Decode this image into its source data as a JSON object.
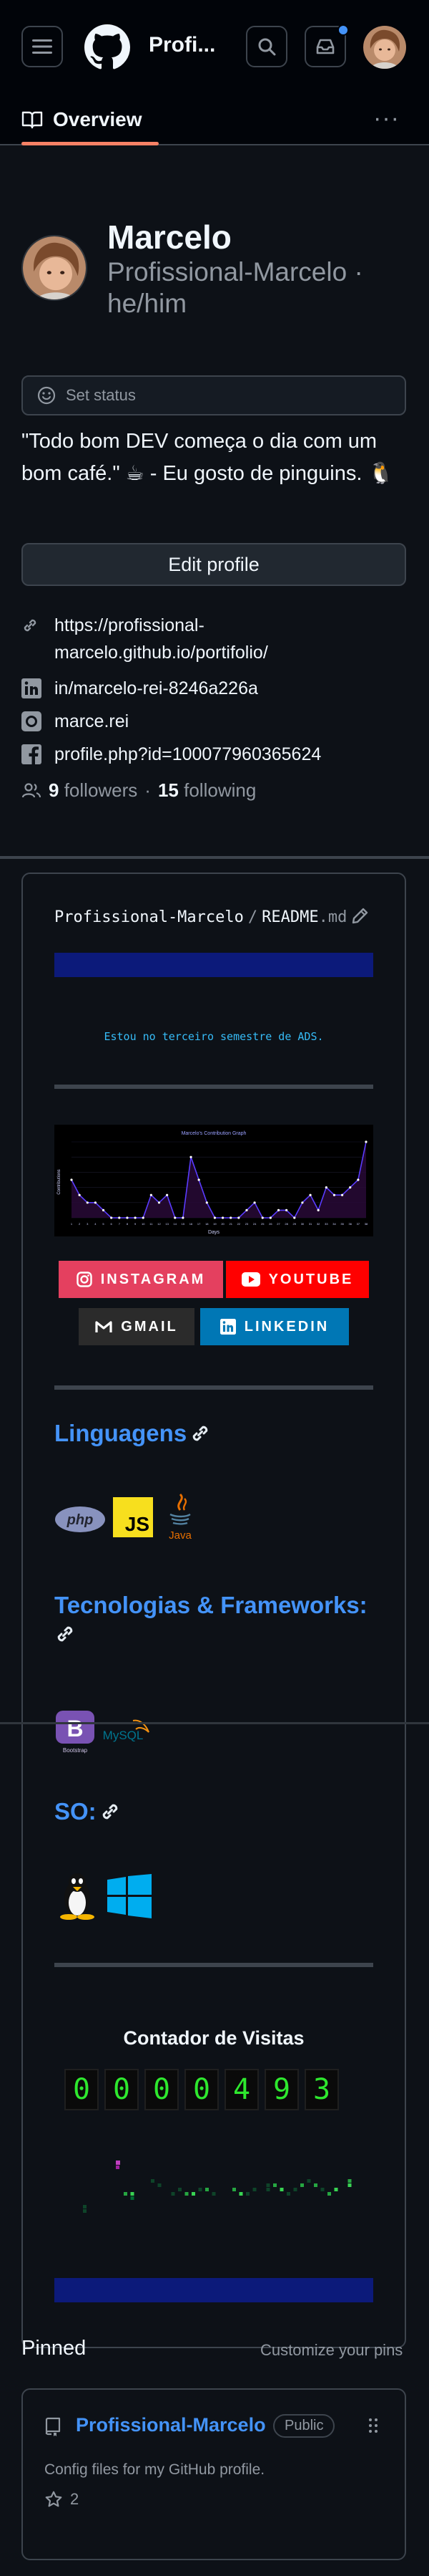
{
  "header": {
    "title": "Profi...",
    "icons": [
      "hamburger-menu-icon",
      "github-logo-icon",
      "search-icon",
      "inbox-icon",
      "avatar"
    ],
    "notification_dot_color": "#4493f8"
  },
  "tabs": {
    "overview_label": "Overview",
    "more_icon": "kebab-horizontal-icon",
    "accent": "#f78166"
  },
  "profile": {
    "name": "Marcelo",
    "login": "Profissional-Marcelo · he/him",
    "status_label": "Set status",
    "bio": "\"Todo bom DEV começa o dia com um bom café.\" ☕ - Eu gosto de pinguins. 🐧",
    "edit_label": "Edit profile",
    "website": "https://profissional-marcelo.github.io/portifolio/",
    "linkedin": "in/marcelo-rei-8246a226a",
    "instagram": "marce.rei",
    "facebook": "profile.php?id=100077960365624",
    "followers_count": "9",
    "followers_label": "followers",
    "following_count": "15",
    "following_label": "following"
  },
  "readme": {
    "owner": "Profissional-Marcelo",
    "slash": "/",
    "file_name": "README",
    "file_ext": ".md",
    "typing_text": "Estou no terceiro semestre de ADS.",
    "graph": {
      "title": "Marcelo's Contribution Graph",
      "xlabel": "Days",
      "ylabel": "Contributions",
      "values": [
        5,
        3,
        2,
        2,
        1,
        0,
        0,
        0,
        0,
        0,
        3,
        2,
        3,
        0,
        0,
        8,
        5,
        2,
        0,
        0,
        0,
        0,
        1,
        2,
        0,
        0,
        1,
        1,
        0,
        2,
        3,
        1,
        4,
        3,
        3,
        4,
        5,
        10
      ],
      "line_color": "#5a3cff",
      "point_color": "#ffffff"
    },
    "badges": {
      "instagram": "INSTAGRAM",
      "youtube": "YOUTUBE",
      "gmail": "GMAIL",
      "linkedin": "LINKEDIN"
    },
    "languages_title": "Linguagens",
    "language_logos": [
      "php",
      "JS",
      "Java"
    ],
    "frameworks_title": "Tecnologias & Frameworks:",
    "framework_logos": [
      "B",
      "Bootstrap",
      "MySQL"
    ],
    "os_title": "SO:",
    "os_icons": [
      "linux-tux-icon",
      "windows-icon"
    ],
    "counter_title": "Contador de Visitas",
    "counter_digits": [
      "0",
      "0",
      "0",
      "0",
      "4",
      "9",
      "3"
    ]
  },
  "pinned": {
    "title": "Pinned",
    "customize": "Customize your pins",
    "repo_name": "Profissional-Marcelo",
    "visibility": "Public",
    "description": "Config files for my GitHub profile.",
    "stars": "2"
  }
}
